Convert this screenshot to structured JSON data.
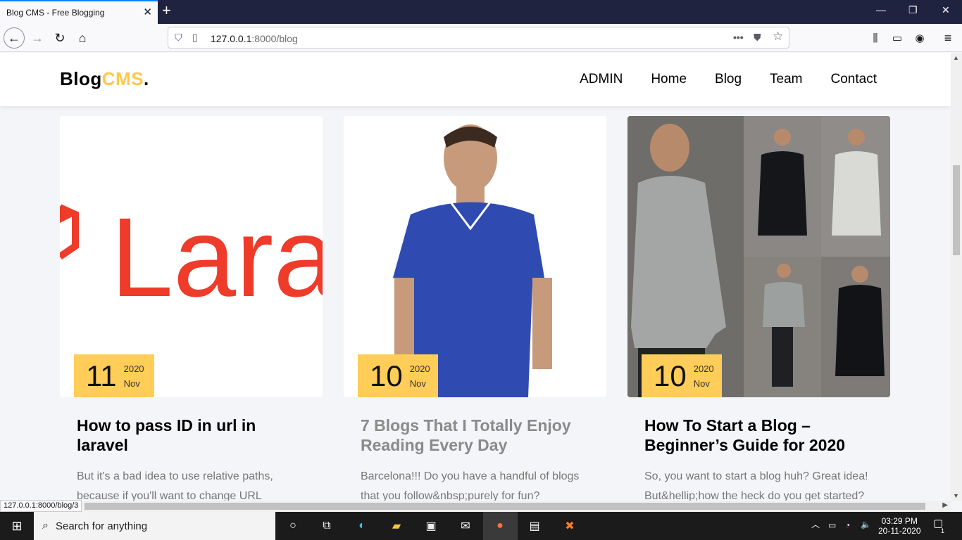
{
  "browser": {
    "tab_title": "Blog CMS - Free Blogging",
    "url_host": "127.0.0.1",
    "url_rest": ":8000/blog",
    "status_url": "127.0.0.1:8000/blog/3"
  },
  "site": {
    "logo_main": "Blog",
    "logo_accent": "CMS",
    "logo_dot": ".",
    "menu": [
      "ADMIN",
      "Home",
      "Blog",
      "Team",
      "Contact"
    ]
  },
  "posts": [
    {
      "day": "11",
      "year": "2020",
      "month": "Nov",
      "title": "How to pass ID in url in laravel",
      "excerpt": "But it's a bad idea to use relative paths, because if you'll want to change URL",
      "image_text": "Lara"
    },
    {
      "day": "10",
      "year": "2020",
      "month": "Nov",
      "title": "7 Blogs That I Totally Enjoy Reading Every Day",
      "excerpt": "Barcelona!!! Do you have a handful of blogs that you follow&nbsp;purely for fun?"
    },
    {
      "day": "10",
      "year": "2020",
      "month": "Nov",
      "title": "How To Start a Blog – Beginner’s Guide for 2020",
      "excerpt": "So, you want to start a blog huh? Great idea! But&hellip;how the heck do you get started?"
    }
  ],
  "taskbar": {
    "search_placeholder": "Search for anything",
    "time": "03:29 PM",
    "date": "20-11-2020",
    "notification_count": "1"
  },
  "colors": {
    "accent": "#ffc84d",
    "date_badge": "#ffcd58",
    "titlebar": "#202340"
  }
}
